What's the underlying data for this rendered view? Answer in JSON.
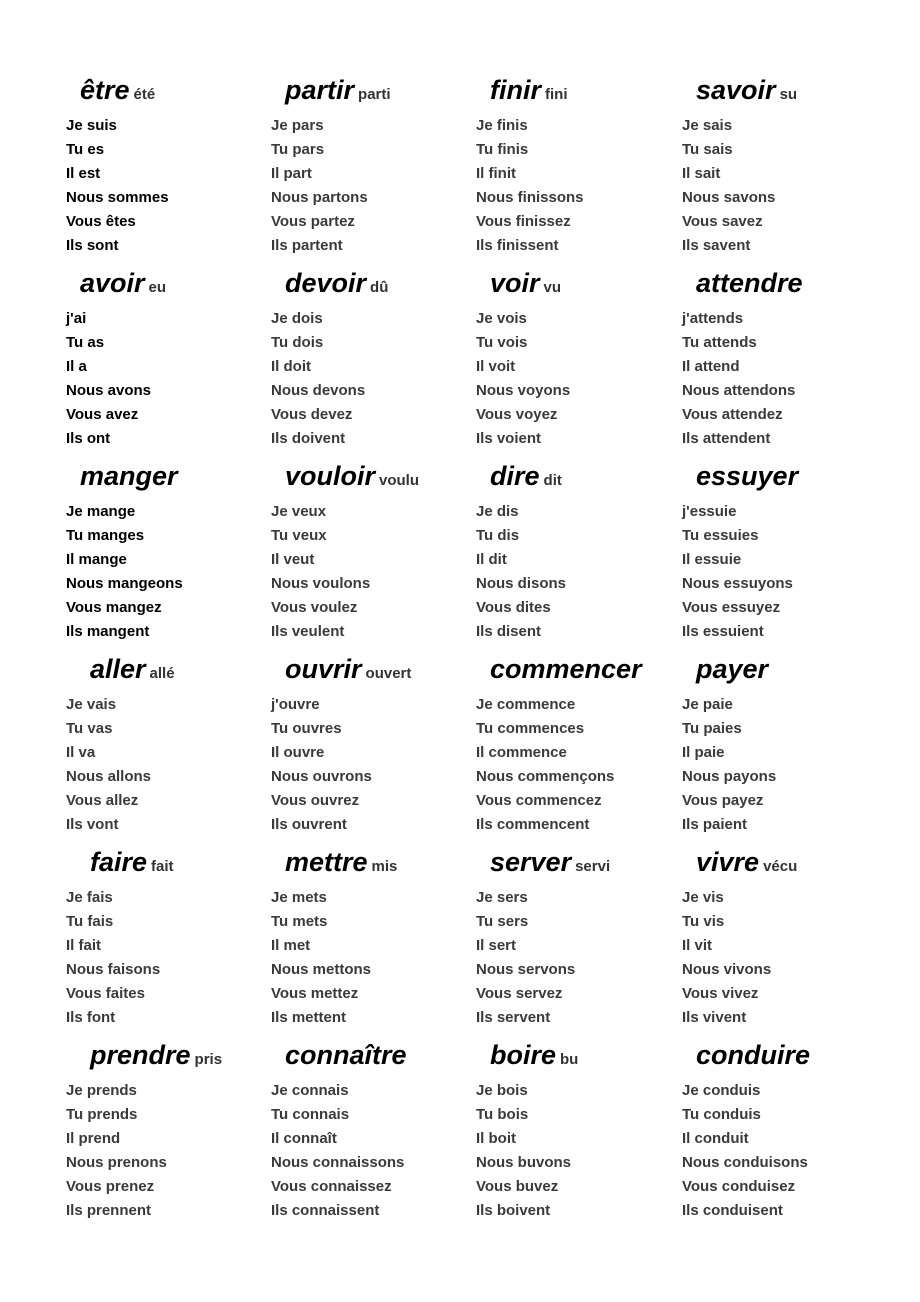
{
  "verbs": [
    {
      "verb": "être",
      "participle": "été",
      "dark": true,
      "forms": [
        "Je suis",
        "Tu es",
        "Il est",
        "Nous sommes",
        "Vous êtes",
        "Ils sont"
      ]
    },
    {
      "verb": "partir",
      "participle": "parti",
      "forms": [
        "Je pars",
        "Tu pars",
        "Il part",
        "Nous partons",
        "Vous partez",
        "Ils partent"
      ]
    },
    {
      "verb": "finir",
      "participle": "fini",
      "forms": [
        "Je finis",
        "Tu finis",
        "Il finit",
        "Nous finissons",
        "Vous finissez",
        "Ils finissent"
      ]
    },
    {
      "verb": "savoir",
      "participle": "su",
      "forms": [
        "Je sais",
        "Tu sais",
        "Il sait",
        "Nous savons",
        "Vous savez",
        "Ils savent"
      ]
    },
    {
      "verb": "avoir",
      "participle": "eu",
      "dark": true,
      "forms": [
        "j'ai",
        "Tu as",
        "Il a",
        "Nous avons",
        "Vous avez",
        "Ils ont"
      ]
    },
    {
      "verb": "devoir",
      "participle": "dû",
      "forms": [
        "Je dois",
        "Tu dois",
        "Il doit",
        "Nous devons",
        "Vous devez",
        "Ils doivent"
      ]
    },
    {
      "verb": "voir",
      "participle": "vu",
      "forms": [
        "Je vois",
        "Tu vois",
        "Il voit",
        "Nous voyons",
        "Vous voyez",
        "Ils voient"
      ]
    },
    {
      "verb": "attendre",
      "participle": "",
      "forms": [
        "j'attends",
        "Tu attends",
        "Il attend",
        "Nous attendons",
        "Vous attendez",
        "Ils attendent"
      ]
    },
    {
      "verb": "manger",
      "participle": "",
      "dark": true,
      "forms": [
        "Je mange",
        "Tu manges",
        "Il mange",
        "Nous mangeons",
        "Vous mangez",
        "Ils mangent"
      ]
    },
    {
      "verb": "vouloir",
      "participle": "voulu",
      "forms": [
        "Je veux",
        "Tu veux",
        "Il veut",
        "Nous voulons",
        "Vous voulez",
        "Ils veulent"
      ]
    },
    {
      "verb": "dire",
      "participle": "dit",
      "forms": [
        "Je dis",
        "Tu dis",
        "Il dit",
        "Nous disons",
        "Vous dites",
        "Ils disent"
      ]
    },
    {
      "verb": "essuyer",
      "participle": "",
      "forms": [
        "j'essuie",
        "Tu essuies",
        "Il essuie",
        "Nous essuyons",
        "Vous essuyez",
        "Ils essuient"
      ]
    },
    {
      "verb": "aller",
      "participle": "allé",
      "forms": [
        "Je vais",
        "Tu vas",
        "Il va",
        "Nous allons",
        "Vous allez",
        "Ils vont"
      ]
    },
    {
      "verb": "ouvrir",
      "participle": "ouvert",
      "forms": [
        "j'ouvre",
        "Tu ouvres",
        "Il ouvre",
        "Nous ouvrons",
        "Vous ouvrez",
        "Ils ouvrent"
      ]
    },
    {
      "verb": "commencer",
      "participle": "",
      "forms": [
        "Je commence",
        "Tu commences",
        "Il commence",
        "Nous commençons",
        "Vous commencez",
        "Ils commencent"
      ]
    },
    {
      "verb": "payer",
      "participle": "",
      "forms": [
        "Je paie",
        "Tu paies",
        "Il paie",
        "Nous payons",
        "Vous payez",
        "Ils paient"
      ]
    },
    {
      "verb": "faire",
      "participle": "fait",
      "forms": [
        "Je fais",
        "Tu fais",
        "Il fait",
        "Nous faisons",
        "Vous faites",
        "Ils font"
      ]
    },
    {
      "verb": "mettre",
      "participle": "mis",
      "forms": [
        "Je mets",
        "Tu mets",
        "Il met",
        "Nous mettons",
        "Vous mettez",
        "Ils mettent"
      ]
    },
    {
      "verb": "server",
      "participle": "servi",
      "forms": [
        "Je sers",
        "Tu sers",
        "Il sert",
        "Nous servons",
        "Vous servez",
        "Ils servent"
      ]
    },
    {
      "verb": "vivre",
      "participle": "vécu",
      "forms": [
        "Je vis",
        "Tu vis",
        "Il vit",
        "Nous vivons",
        "Vous vivez",
        "Ils vivent"
      ]
    },
    {
      "verb": "prendre",
      "participle": "pris",
      "forms": [
        "Je prends",
        "Tu prends",
        "Il prend",
        "Nous prenons",
        "Vous prenez",
        "Ils prennent"
      ]
    },
    {
      "verb": "connaître",
      "participle": "",
      "forms": [
        "Je connais",
        "Tu connais",
        "Il connaît",
        "Nous connaissons",
        "Vous connaissez",
        "Ils connaissent"
      ]
    },
    {
      "verb": "boire",
      "participle": "bu",
      "forms": [
        "Je bois",
        "Tu bois",
        "Il boit",
        "Nous buvons",
        "Vous buvez",
        "Ils boivent"
      ]
    },
    {
      "verb": "conduire",
      "participle": "",
      "forms": [
        "Je conduis",
        "Tu conduis",
        "Il conduit",
        "Nous conduisons",
        "Vous conduisez",
        "Ils conduisent"
      ]
    }
  ]
}
